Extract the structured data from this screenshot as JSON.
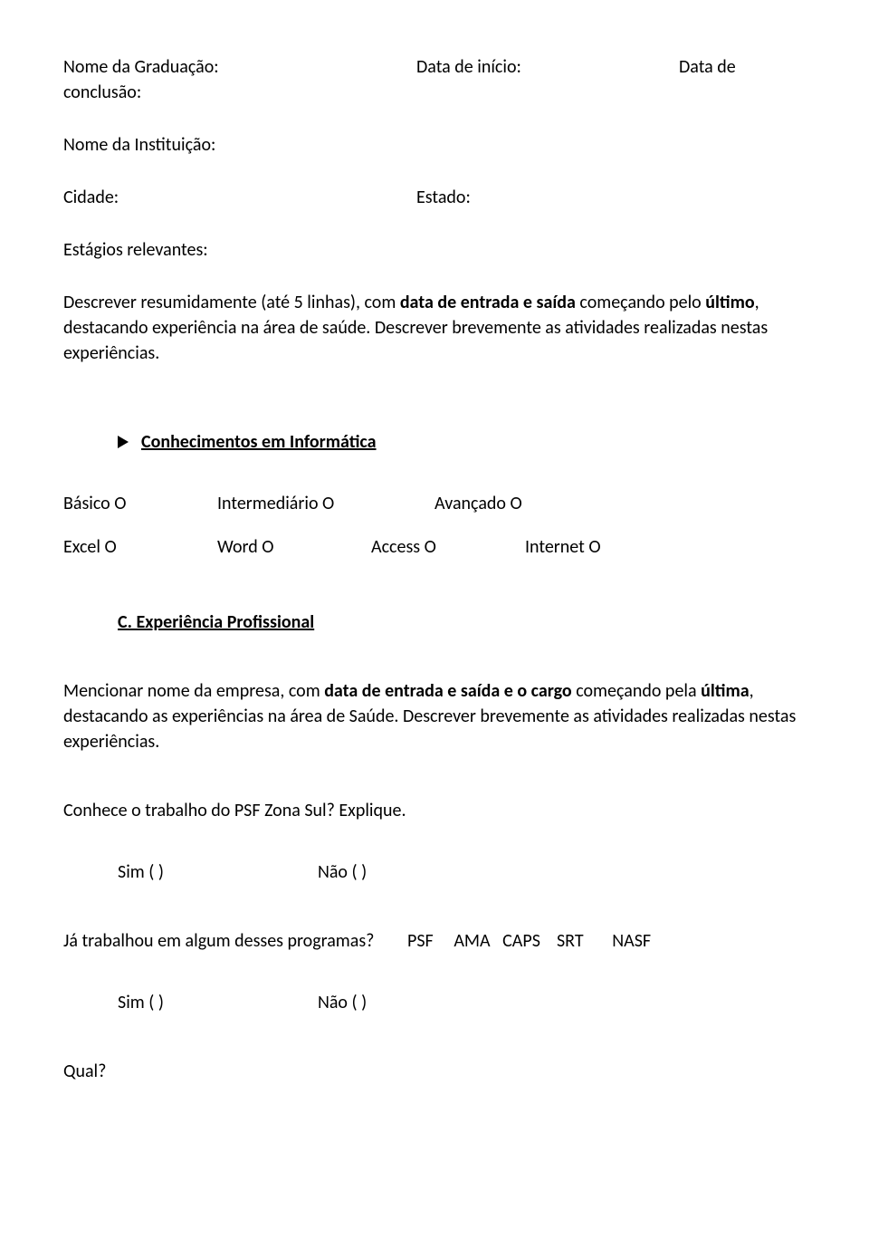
{
  "header": {
    "grad_label": "Nome da Graduação:",
    "inicio_label": "Data de início:",
    "fim_label": "Data de",
    "conclusao": "conclusão:",
    "inst_label": "Nome da Instituição:",
    "cidade_label": "Cidade:",
    "estado_label": "Estado:",
    "estagios_label": "Estágios relevantes:",
    "resume_pre": "Descrever resumidamente (até 5 linhas), com ",
    "resume_bold1": "data de entrada e saída",
    "resume_mid": " começando pelo ",
    "resume_bold2": "último",
    "resume_post": ", destacando experiência na área de saúde. Descrever brevemente as atividades realizadas nestas experiências."
  },
  "informatica": {
    "heading": "Conhecimentos em Informática",
    "row1": {
      "a": "Básico O",
      "b": "Intermediário O",
      "c": "Avançado O"
    },
    "row2": {
      "a": "Excel O",
      "b": "Word O",
      "c": "Access O",
      "d": "Internet O"
    }
  },
  "experiencia": {
    "heading": "C.   Experiência Profissional",
    "body_pre": "Mencionar nome da empresa, com ",
    "body_bold1": "data de entrada e saída e o cargo",
    "body_mid": " começando pela ",
    "body_bold2": "última",
    "body_post": ", destacando as experiências na área de Saúde. Descrever brevemente as atividades realizadas nestas experiências.",
    "psf_question": "Conhece o trabalho do PSF Zona Sul? Explique.",
    "sim": "Sim (   )",
    "nao": "Não (   )",
    "programas_label": "Já trabalhou em algum desses programas?",
    "programas_opts": "PSF     AMA   CAPS    SRT       NASF",
    "qual": "Qual?"
  }
}
